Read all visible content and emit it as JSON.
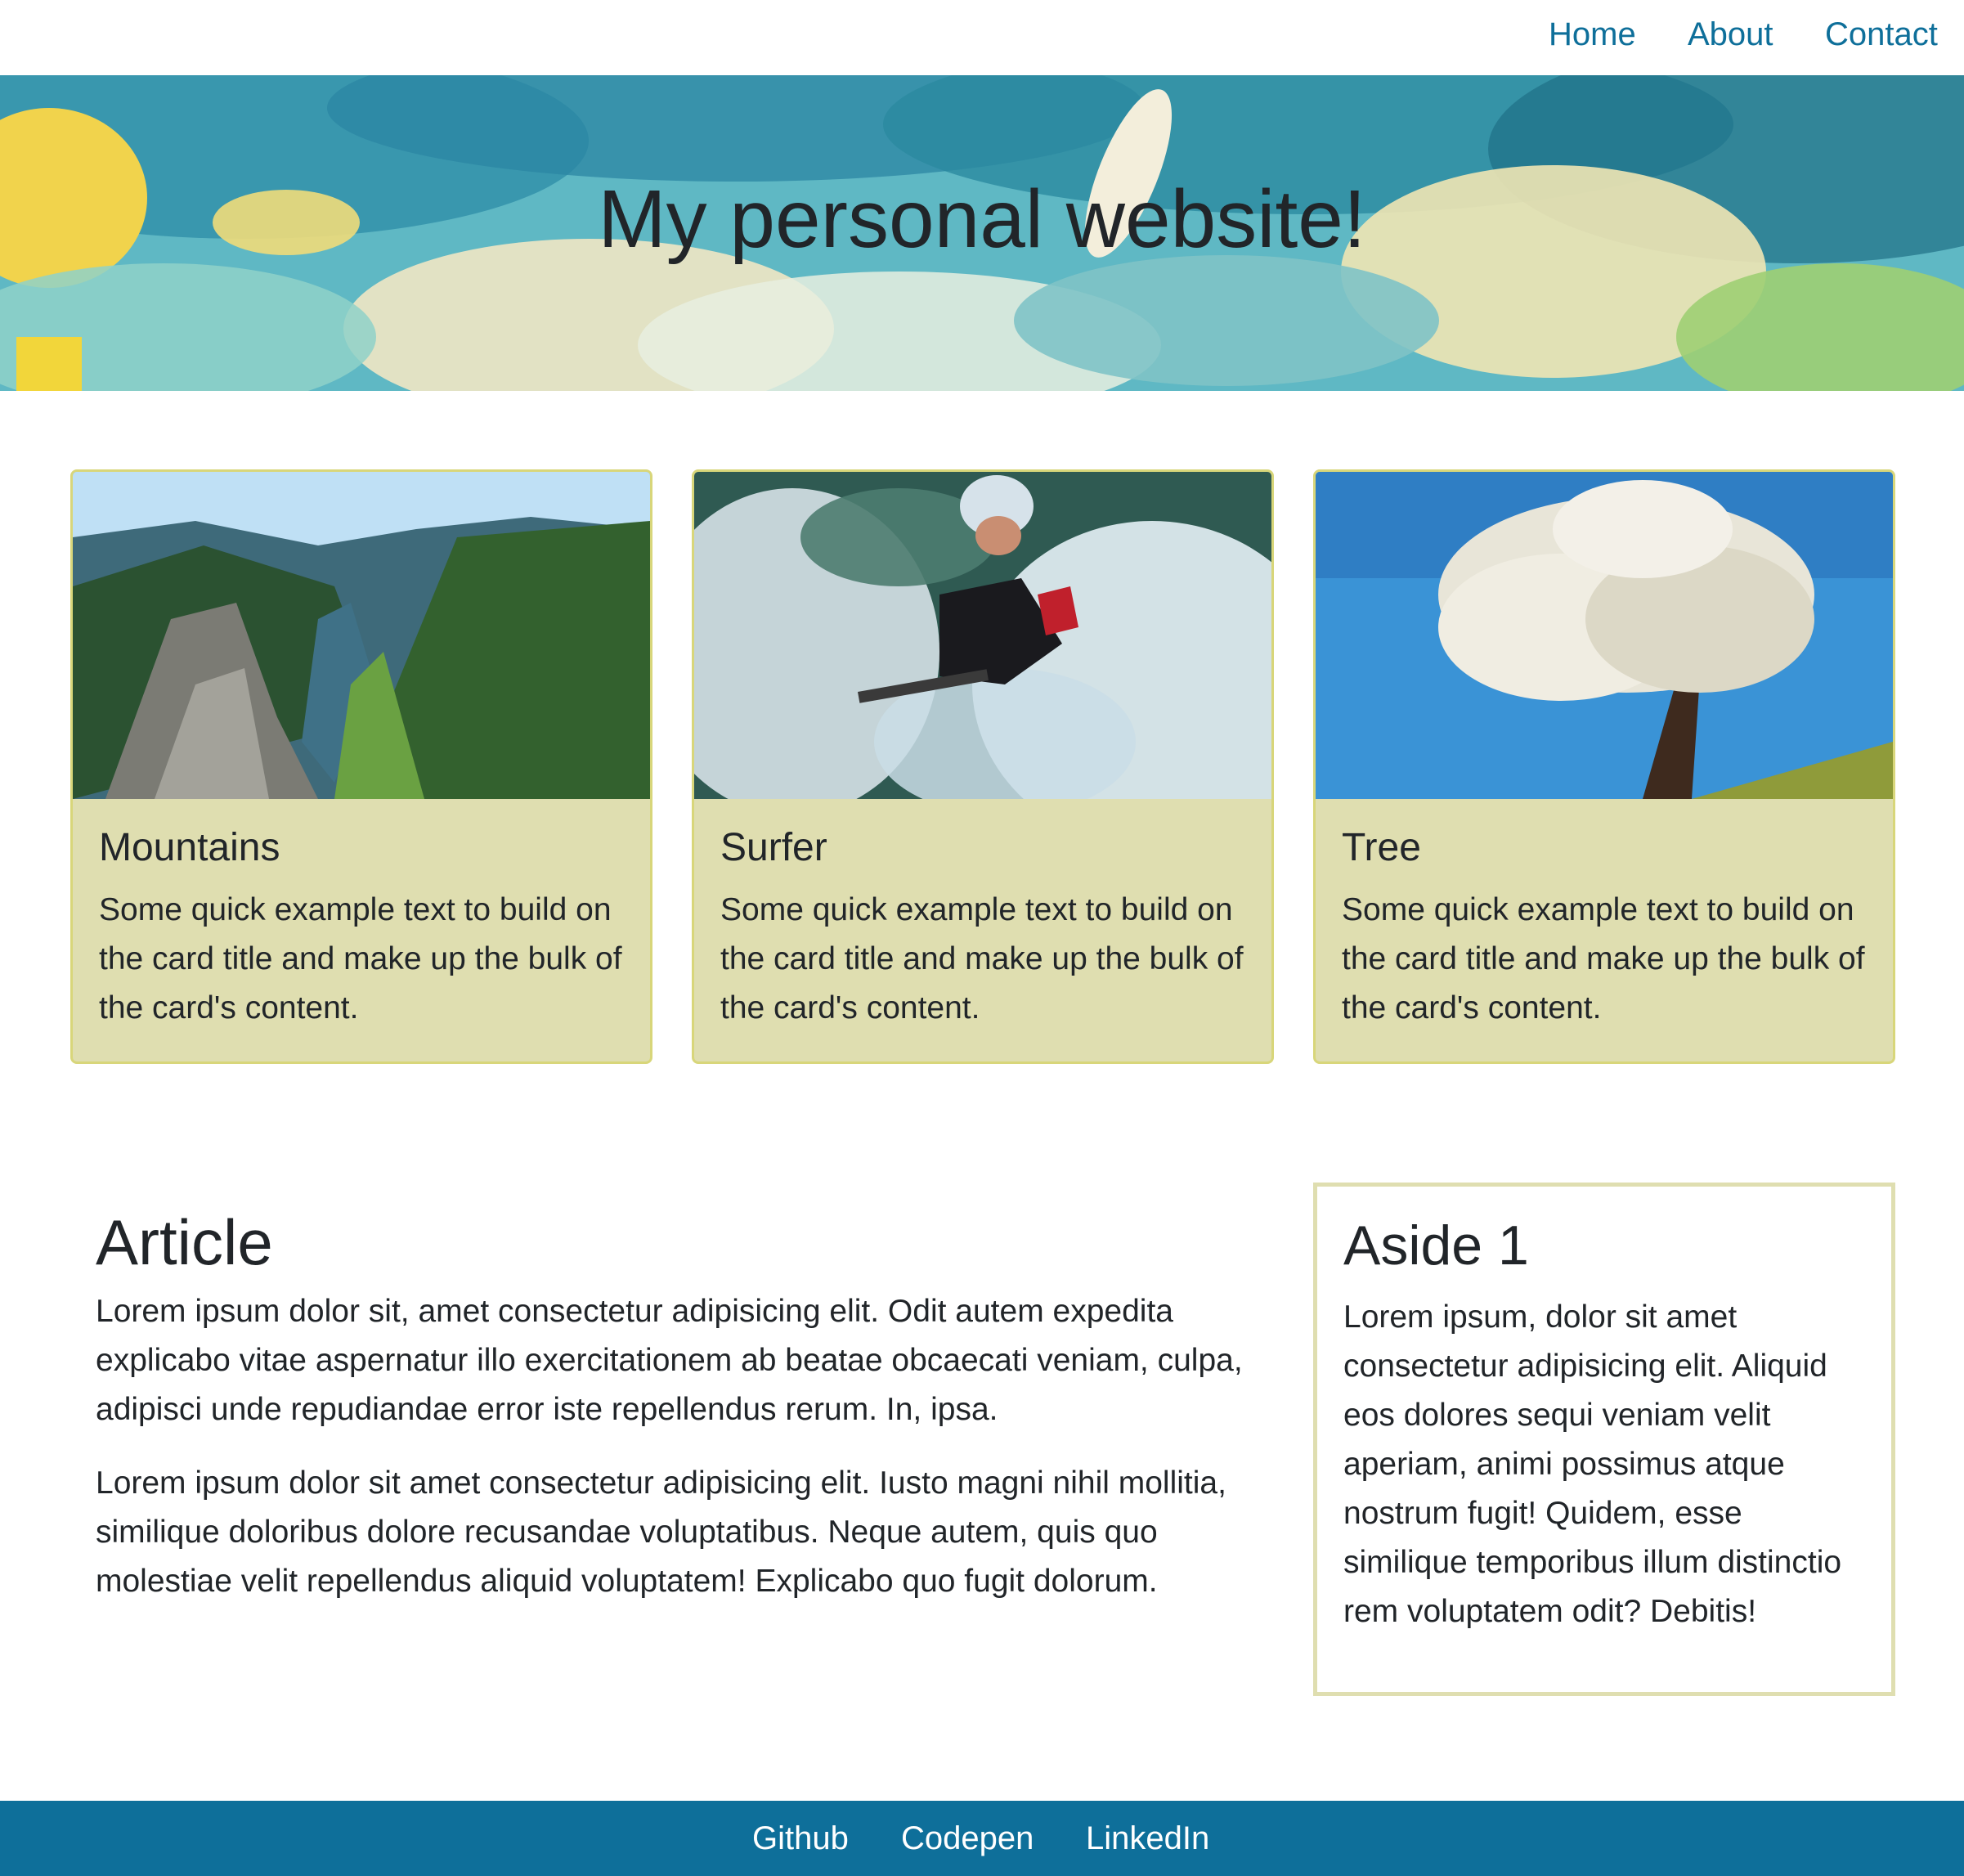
{
  "nav": {
    "links": [
      {
        "label": "Home"
      },
      {
        "label": "About"
      },
      {
        "label": "Contact"
      }
    ]
  },
  "hero": {
    "title": "My personal website!"
  },
  "cards": [
    {
      "title": "Mountains",
      "text": "Some quick example text to build on the card title and make up the bulk of the card's content."
    },
    {
      "title": "Surfer",
      "text": "Some quick example text to build on the card title and make up the bulk of the card's content."
    },
    {
      "title": "Tree",
      "text": "Some quick example text to build on the card title and make up the bulk of the card's content."
    }
  ],
  "article": {
    "heading": "Article",
    "paragraphs": [
      "Lorem ipsum dolor sit, amet consectetur adipisicing elit. Odit autem expedita explicabo vitae aspernatur illo exercitationem ab beatae obcaecati veniam, culpa, adipisci unde repudiandae error iste repellendus rerum. In, ipsa.",
      "Lorem ipsum dolor sit amet consectetur adipisicing elit. Iusto magni nihil mollitia, similique doloribus dolore recusandae voluptatibus. Neque autem, quis quo molestiae velit repellendus aliquid voluptatem! Explicabo quo fugit dolorum."
    ]
  },
  "aside": {
    "heading": "Aside 1",
    "text": "Lorem ipsum, dolor sit amet consectetur adipisicing elit. Aliquid eos dolores sequi veniam velit aperiam, animi possimus atque nostrum fugit! Quidem, esse similique temporibus illum distinctio rem voluptatem odit? Debitis!"
  },
  "footer": {
    "links": [
      {
        "label": "Github"
      },
      {
        "label": "Codepen"
      },
      {
        "label": "LinkedIn"
      }
    ]
  },
  "colors": {
    "link": "#0e6f9a",
    "footer_bg": "#0e6f9a",
    "card_bg": "#dfdeb0",
    "card_border": "#d8d67a",
    "aside_border": "#dfdeb0"
  }
}
